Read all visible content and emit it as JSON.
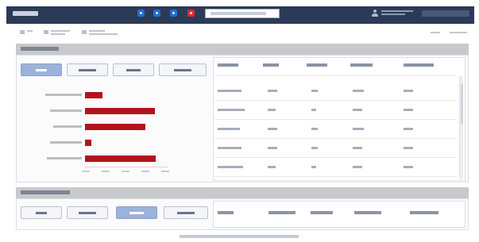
{
  "header": {
    "colors": {
      "bar": "#2b3a57",
      "blue": "#1f6fd1",
      "red": "#d92c2c"
    },
    "nav_icons": [
      "facebook-icon",
      "twitter-icon",
      "help-icon",
      "notification-icon"
    ]
  },
  "section1": {
    "filter_buttons": [
      {
        "name": "filter-button-1",
        "active": true
      },
      {
        "name": "filter-button-2",
        "active": false
      },
      {
        "name": "filter-button-3",
        "active": false
      },
      {
        "name": "filter-button-4",
        "active": false
      }
    ]
  },
  "section2": {
    "filter_buttons": [
      {
        "name": "filter-button-1",
        "active": false
      },
      {
        "name": "filter-button-2",
        "active": false
      },
      {
        "name": "filter-button-3",
        "active": true
      },
      {
        "name": "filter-button-4",
        "active": false
      }
    ]
  },
  "chart_data": {
    "type": "bar",
    "orientation": "horizontal",
    "bar_color": "#b3121c",
    "values": [
      22,
      88,
      76,
      8,
      89
    ]
  }
}
